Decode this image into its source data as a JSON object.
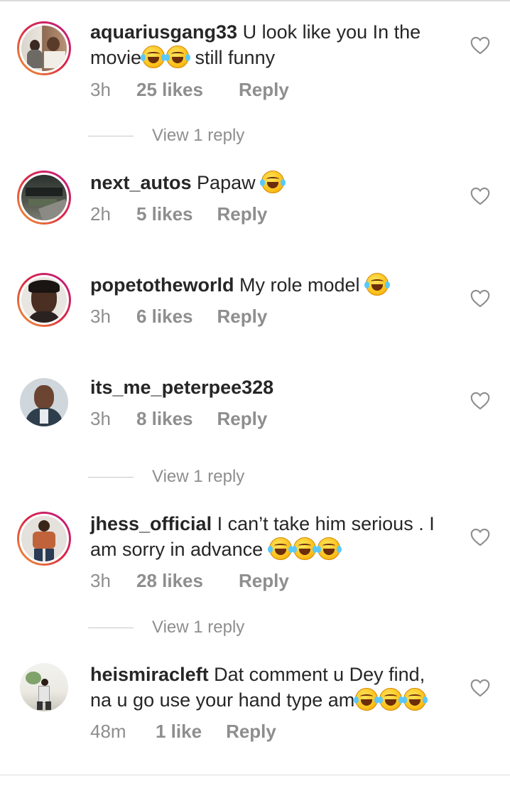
{
  "colors": {
    "text": "#262626",
    "muted": "#8e8e8e",
    "story_ring_start": "#f09433",
    "story_ring_end": "#bc1888"
  },
  "comments": [
    {
      "username": "aquariusgang33",
      "text_line1": " U look like you In the",
      "text_line2_pre": "movie",
      "emoji_count_a": 2,
      "text_line2_post": " still funny",
      "time": "3h",
      "likes": "25 likes",
      "reply": "Reply",
      "view_replies": "View 1 reply",
      "icon": "heart-outline-icon"
    },
    {
      "username": "next_autos",
      "text": " Papaw ",
      "time": "2h",
      "likes": "5 likes",
      "reply": "Reply",
      "icon": "heart-outline-icon"
    },
    {
      "username": "popetotheworld",
      "text": " My role model ",
      "time": "3h",
      "likes": "6 likes",
      "reply": "Reply",
      "icon": "heart-outline-icon"
    },
    {
      "username": "its_me_peterpee328",
      "text": "",
      "time": "3h",
      "likes": "8 likes",
      "reply": "Reply",
      "view_replies": "View 1 reply",
      "icon": "heart-outline-icon"
    },
    {
      "username": "jhess_official",
      "text_line1": " I can’t take him serious . I",
      "text_line2": "am sorry in advance ",
      "time": "3h",
      "likes": "28 likes",
      "reply": "Reply",
      "view_replies": "View 1 reply",
      "icon": "heart-outline-icon"
    },
    {
      "username": "heismiracleft",
      "text_line1": " Dat comment u Dey find,",
      "text_line2": "na u go use your hand type am",
      "time": "48m",
      "likes": "1 like",
      "reply": "Reply",
      "icon": "heart-outline-icon"
    }
  ]
}
